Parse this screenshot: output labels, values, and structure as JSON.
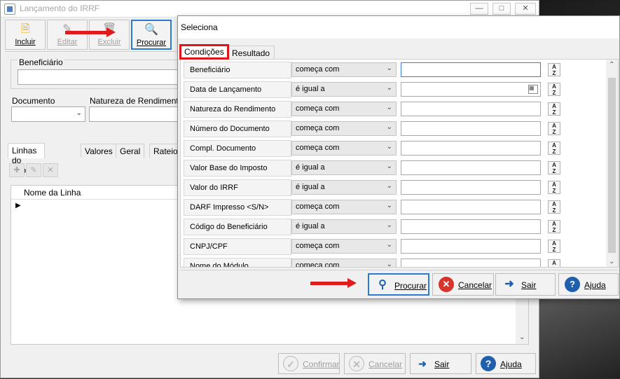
{
  "main_window": {
    "title": "Lançamento do IRRF",
    "toolbar": {
      "incluir": "Incluir",
      "editar": "Editar",
      "excluir": "Excluir",
      "procurar": "Procurar"
    },
    "form": {
      "beneficiario_label": "Beneficiário",
      "documento_label": "Documento",
      "natureza_label": "Natureza de Rendimento"
    },
    "tabs": [
      "Linhas do Informe",
      "Valores",
      "Geral",
      "Rateio"
    ],
    "grid": {
      "column": "Nome da Linha"
    },
    "bottom": {
      "confirmar": "Confirmar",
      "cancelar": "Cancelar",
      "sair": "Sair",
      "ajuda": "Ajuda"
    }
  },
  "dialog": {
    "title": "Seleciona",
    "tabs": {
      "condicoes": "Condições",
      "resultado": "Resultado"
    },
    "conditions": [
      {
        "field": "Beneficiário",
        "operator": "começa com",
        "value": ""
      },
      {
        "field": "Data de Lançamento",
        "operator": "é igual a",
        "value": ""
      },
      {
        "field": "Natureza do Rendimento",
        "operator": "começa com",
        "value": ""
      },
      {
        "field": "Número do Documento",
        "operator": "começa com",
        "value": ""
      },
      {
        "field": "Compl. Documento",
        "operator": "começa com",
        "value": ""
      },
      {
        "field": "Valor Base do Imposto",
        "operator": "é igual a",
        "value": ""
      },
      {
        "field": "Valor do IRRF",
        "operator": "é igual a",
        "value": ""
      },
      {
        "field": "DARF Impresso <S/N>",
        "operator": "começa com",
        "value": ""
      },
      {
        "field": "Código do Beneficiário",
        "operator": "é igual a",
        "value": ""
      },
      {
        "field": "CNPJ/CPF",
        "operator": "começa com",
        "value": ""
      },
      {
        "field": "Nome do Módulo",
        "operator": "começa com",
        "value": ""
      }
    ],
    "footer": {
      "procurar": "Procurar",
      "cancelar": "Cancelar",
      "sair": "Sair",
      "ajuda": "Ajuda"
    }
  },
  "colors": {
    "highlight": "#e0141b",
    "focus": "#2b79d0"
  }
}
